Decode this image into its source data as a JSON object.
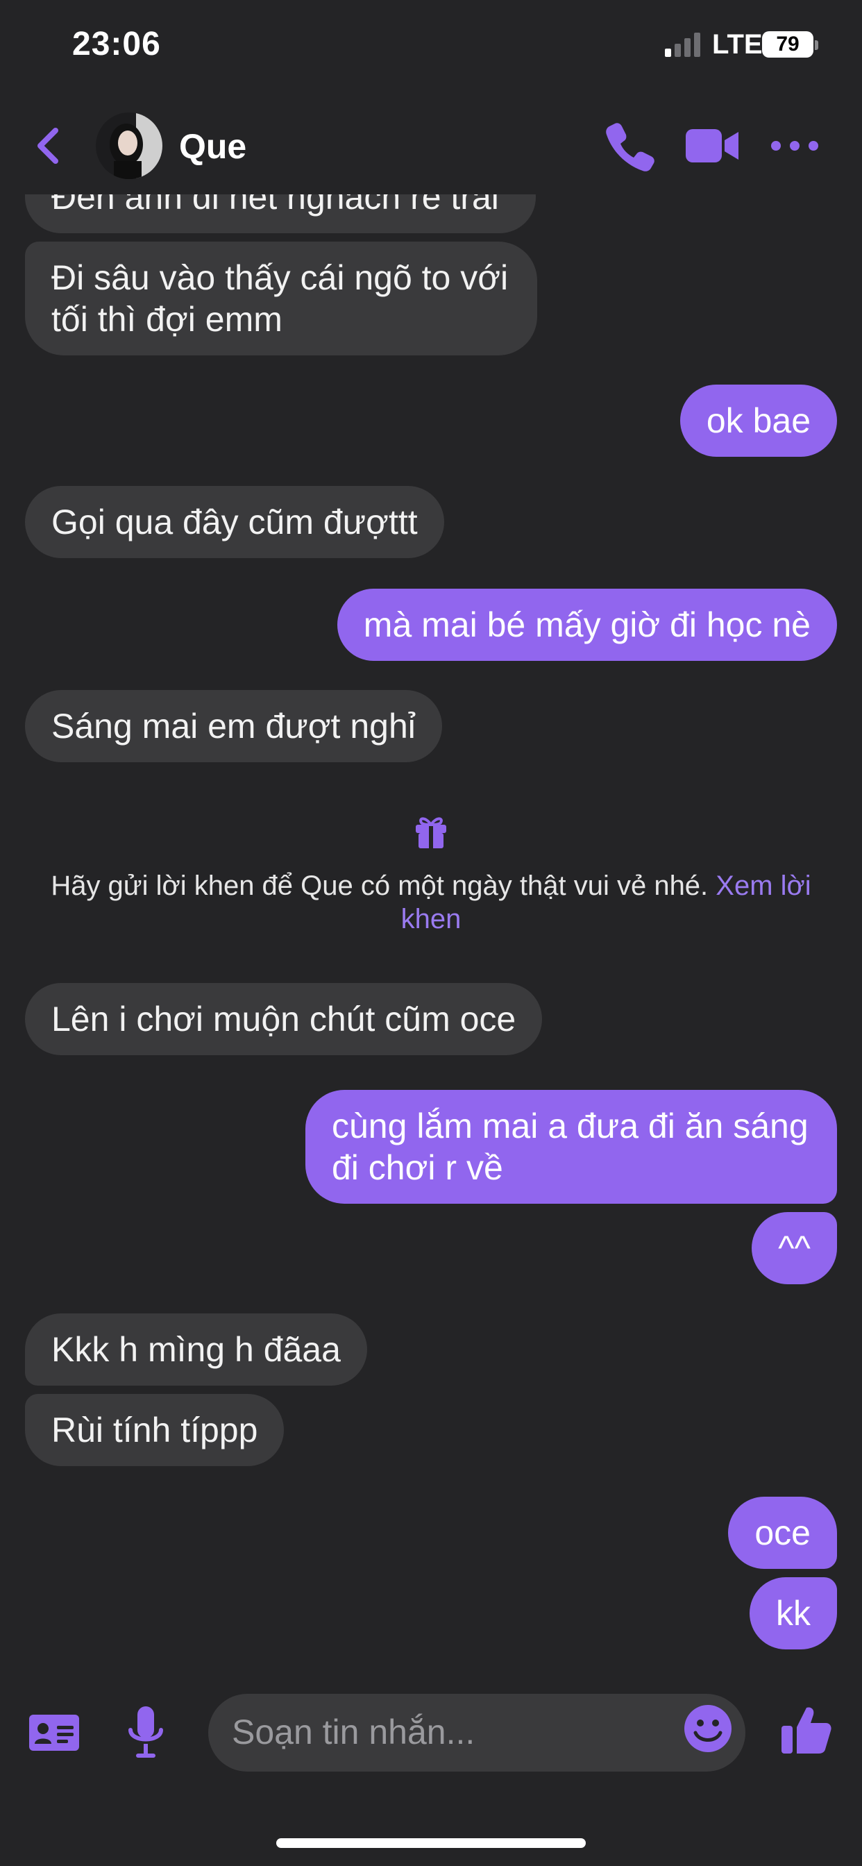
{
  "status_bar": {
    "time": "23:06",
    "network": "LTE",
    "battery": "79"
  },
  "header": {
    "contact_name": "Que",
    "icons": [
      "back-chevron-icon",
      "phone-icon",
      "video-icon",
      "more-icon"
    ]
  },
  "messages": [
    {
      "side": "in",
      "text": "Đến anh đi hết nghách rẽ trái"
    },
    {
      "side": "in",
      "text": "Đi sâu vào thấy cái ngõ to với tối thì đợi emm"
    },
    {
      "side": "out",
      "text": "ok bae"
    },
    {
      "side": "in",
      "text": "Gọi qua đây cũm đượttt"
    },
    {
      "side": "out",
      "text": "mà mai bé mấy giờ đi học nè"
    },
    {
      "side": "in",
      "text": "Sáng mai em đượt nghỉ"
    },
    {
      "side": "in",
      "text": "Lên i chơi muộn chút cũm oce"
    },
    {
      "side": "out",
      "text": "cùng lắm mai a đưa đi ăn sáng đi chơi r về"
    },
    {
      "side": "out",
      "text": "^^"
    },
    {
      "side": "in",
      "text": "Kkk h mìng h đãaa"
    },
    {
      "side": "in",
      "text": "Rùi tính típpp"
    },
    {
      "side": "out",
      "text": "oce"
    },
    {
      "side": "out",
      "text": "kk"
    }
  ],
  "compliment_prompt": {
    "text": "Hãy gửi lời khen để Que có một ngày thật vui vẻ nhé.",
    "link": "Xem lời khen"
  },
  "composer": {
    "placeholder": "Soạn tin nhắn..."
  },
  "colors": {
    "accent": "#9166ee",
    "background": "#242426",
    "incoming_bubble": "#3a3a3c"
  }
}
